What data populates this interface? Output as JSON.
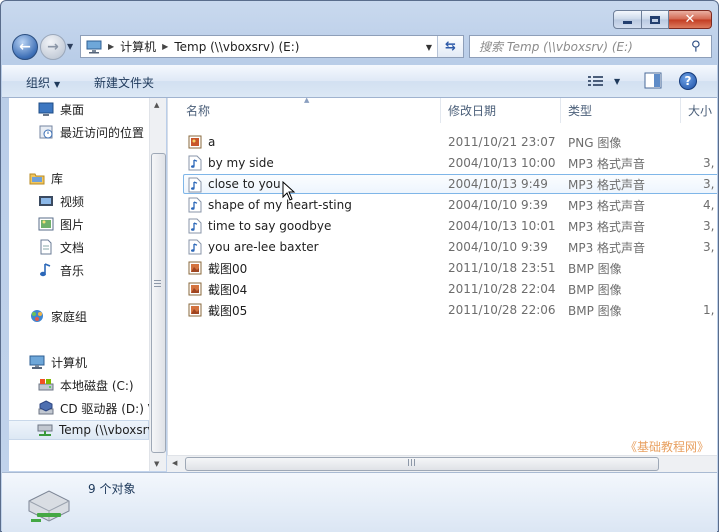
{
  "window": {
    "minimize_icon": "minimize-icon",
    "maximize_icon": "maximize-icon",
    "close_glyph": "✕"
  },
  "nav": {
    "back_glyph": "←",
    "forward_glyph": "→",
    "address": {
      "segments": [
        "计算机",
        "Temp (\\\\vboxsrv) (E:)"
      ]
    },
    "search_placeholder": "搜索 Temp (\\\\vboxsrv) (E:)"
  },
  "toolbar": {
    "organize_label": "组织",
    "new_folder_label": "新建文件夹"
  },
  "sidebar": {
    "items": [
      {
        "label": "桌面",
        "icon": "desktop-icon"
      },
      {
        "label": "最近访问的位置",
        "icon": "recent-places-icon"
      },
      {
        "label": "库",
        "icon": "library-icon"
      },
      {
        "label": "视频",
        "icon": "video-icon"
      },
      {
        "label": "图片",
        "icon": "pictures-icon"
      },
      {
        "label": "文档",
        "icon": "documents-icon"
      },
      {
        "label": "音乐",
        "icon": "music-icon"
      },
      {
        "label": "家庭组",
        "icon": "homegroup-icon"
      },
      {
        "label": "计算机",
        "icon": "computer-icon"
      },
      {
        "label": "本地磁盘 (C:)",
        "icon": "local-disk-icon"
      },
      {
        "label": "CD 驱动器 (D:) V",
        "icon": "cd-drive-icon"
      },
      {
        "label": "Temp (\\\\vboxsrv)",
        "icon": "network-drive-icon"
      }
    ]
  },
  "columns": {
    "name": "名称",
    "date": "修改日期",
    "type": "类型",
    "size": "大小"
  },
  "files": [
    {
      "name": "a",
      "date": "2011/10/21 23:07",
      "type": "PNG 图像",
      "size": "",
      "icon": "image-file-icon"
    },
    {
      "name": "by my side",
      "date": "2004/10/13 10:00",
      "type": "MP3 格式声音",
      "size": "3,",
      "icon": "audio-file-icon"
    },
    {
      "name": "close to you",
      "date": "2004/10/13 9:49",
      "type": "MP3 格式声音",
      "size": "3,",
      "icon": "audio-file-icon"
    },
    {
      "name": "shape of my heart-sting",
      "date": "2004/10/10 9:39",
      "type": "MP3 格式声音",
      "size": "4,",
      "icon": "audio-file-icon"
    },
    {
      "name": "time to say goodbye",
      "date": "2004/10/13 10:01",
      "type": "MP3 格式声音",
      "size": "3,",
      "icon": "audio-file-icon"
    },
    {
      "name": "you are-lee baxter",
      "date": "2004/10/10 9:39",
      "type": "MP3 格式声音",
      "size": "3,",
      "icon": "audio-file-icon"
    },
    {
      "name": "截图00",
      "date": "2011/10/18 23:51",
      "type": "BMP 图像",
      "size": "",
      "icon": "bitmap-file-icon"
    },
    {
      "name": "截图04",
      "date": "2011/10/28 22:04",
      "type": "BMP 图像",
      "size": "",
      "icon": "bitmap-file-icon"
    },
    {
      "name": "截图05",
      "date": "2011/10/28 22:06",
      "type": "BMP 图像",
      "size": "1,",
      "icon": "bitmap-file-icon"
    }
  ],
  "watermark": "《基础教程网》",
  "details": {
    "count": "9 个对象"
  }
}
